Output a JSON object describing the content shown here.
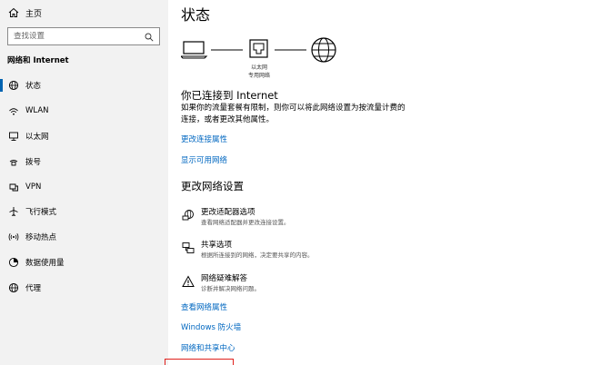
{
  "sidebar": {
    "home_label": "主页",
    "search_placeholder": "查找设置",
    "section_title": "网络和 Internet",
    "items": [
      {
        "label": "状态",
        "icon": "status-globe-icon",
        "active": true
      },
      {
        "label": "WLAN",
        "icon": "wifi-icon"
      },
      {
        "label": "以太网",
        "icon": "ethernet-icon"
      },
      {
        "label": "拨号",
        "icon": "dialup-icon"
      },
      {
        "label": "VPN",
        "icon": "vpn-icon"
      },
      {
        "label": "飞行模式",
        "icon": "airplane-icon"
      },
      {
        "label": "移动热点",
        "icon": "hotspot-icon"
      },
      {
        "label": "数据使用量",
        "icon": "data-usage-icon"
      },
      {
        "label": "代理",
        "icon": "proxy-globe-icon"
      }
    ]
  },
  "main": {
    "title": "状态",
    "diagram": {
      "ethernet_label": "以太网",
      "network_type": "专用网络"
    },
    "connected_heading": "你已连接到 Internet",
    "connected_desc": "如果你的流量套餐有限制，则你可以将此网络设置为按流量计费的连接，或者更改其他属性。",
    "link_change_props": "更改连接属性",
    "link_show_networks": "显示可用网络",
    "change_heading": "更改网络设置",
    "options": [
      {
        "title": "更改适配器选项",
        "desc": "查看网络适配器并更改连接设置。",
        "icon": "adapter-icon"
      },
      {
        "title": "共享选项",
        "desc": "根据所连接到的网络，决定要共享的内容。",
        "icon": "sharing-icon"
      },
      {
        "title": "网络疑难解答",
        "desc": "诊断并解决网络问题。",
        "icon": "troubleshoot-warning-icon"
      }
    ],
    "link_view_props": "查看网络属性",
    "link_firewall": "Windows 防火墙",
    "link_sharing_center": "网络和共享中心"
  }
}
